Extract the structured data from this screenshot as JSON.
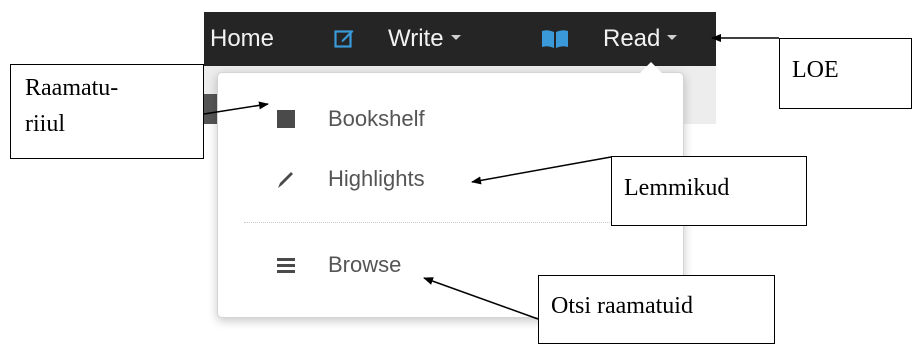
{
  "navbar": {
    "home_label": "Home",
    "write_label": "Write",
    "read_label": "Read",
    "write_icon": "pencil-square-icon",
    "read_icon": "open-book-icon"
  },
  "dropdown": {
    "items": [
      {
        "label": "Bookshelf",
        "icon": "bookshelf-square-icon"
      },
      {
        "label": "Highlights",
        "icon": "pen-icon"
      },
      {
        "label": "Browse",
        "icon": "list-icon"
      }
    ]
  },
  "annotations": {
    "raamaturiiul_line1": "Raamatu-",
    "raamaturiiul_line2": "riiul",
    "loe": "LOE",
    "lemmikud": "Lemmikud",
    "otsi_raamatuid": "Otsi raamatuid"
  },
  "colors": {
    "navbar_bg": "#252525",
    "nav_text": "#f2f2f2",
    "accent_blue": "#3a9ad9",
    "menu_text": "#555555"
  }
}
